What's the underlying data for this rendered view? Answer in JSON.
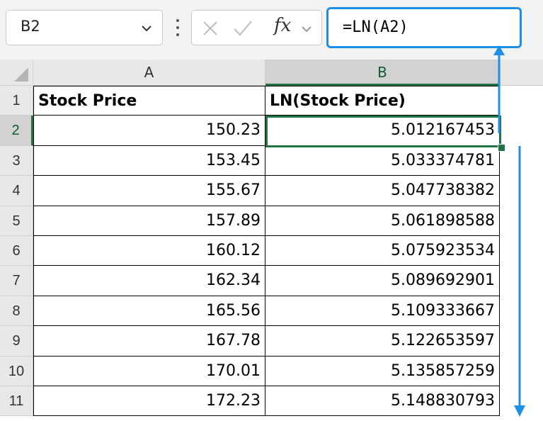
{
  "formula_bar": {
    "name_box": "B2",
    "fx_label": "fx",
    "formula": "=LN(A2)"
  },
  "columns": [
    {
      "id": "A",
      "label": "A"
    },
    {
      "id": "B",
      "label": "B"
    }
  ],
  "rows": [
    "1",
    "2",
    "3",
    "4",
    "5",
    "6",
    "7",
    "8",
    "9",
    "10",
    "11"
  ],
  "table": {
    "headers": [
      "Stock Price",
      "LN(Stock Price)"
    ],
    "data": [
      [
        "150.23",
        "5.012167453"
      ],
      [
        "153.45",
        "5.033374781"
      ],
      [
        "155.67",
        "5.047738382"
      ],
      [
        "157.89",
        "5.061898588"
      ],
      [
        "160.12",
        "5.075923534"
      ],
      [
        "162.34",
        "5.089692901"
      ],
      [
        "165.56",
        "5.109333667"
      ],
      [
        "167.78",
        "5.122653597"
      ],
      [
        "170.01",
        "5.135857259"
      ],
      [
        "172.23",
        "5.148830793"
      ]
    ]
  },
  "selection": {
    "cell": "B2",
    "column": "B",
    "row": "2"
  },
  "colors": {
    "accent_blue": "#1f8fe6",
    "selection_green": "#217346"
  },
  "icons": {
    "name_box_dropdown": "chevron-down-icon",
    "cancel": "close-icon",
    "enter": "checkmark-icon",
    "function": "fx-icon",
    "select_all": "select-all-triangle-icon",
    "annotations": [
      "arrow-up-icon",
      "arrow-down-icon"
    ]
  }
}
